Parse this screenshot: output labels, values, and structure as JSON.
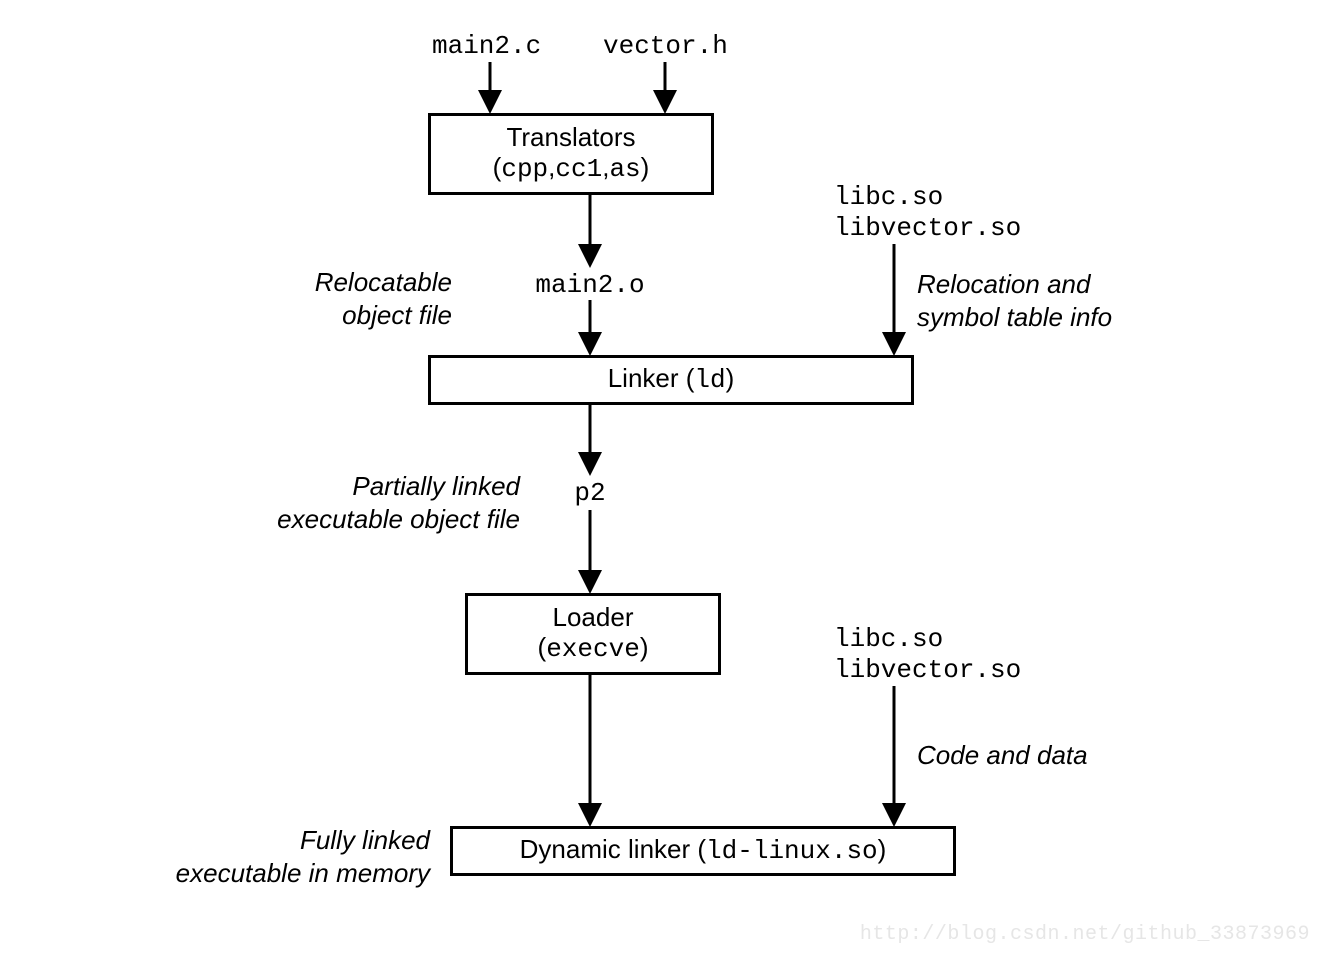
{
  "inputs": {
    "file1": "main2.c",
    "file2": "vector.h"
  },
  "translators": {
    "title": "Translators",
    "subtitle": "(cpp,cc1,as)"
  },
  "relocatable": {
    "line1": "Relocatable",
    "line2": "object file"
  },
  "obj_output": "main2.o",
  "libs1": {
    "line1": "libc.so",
    "line2": "libvector.so"
  },
  "reloc_info": {
    "line1": "Relocation and",
    "line2": "symbol table info"
  },
  "linker": {
    "prefix": "Linker (",
    "mono": "ld",
    "suffix": ")"
  },
  "partially": {
    "line1": "Partially linked",
    "line2": "executable object file"
  },
  "p2": "p2",
  "loader": {
    "title": "Loader",
    "subtitle": "(execve)"
  },
  "libs2": {
    "line1": "libc.so",
    "line2": "libvector.so"
  },
  "code_data": "Code and data",
  "fully": {
    "line1": "Fully linked",
    "line2": "executable in memory"
  },
  "dynlinker": {
    "prefix": "Dynamic linker (",
    "mono": "ld-linux.so",
    "suffix": ")"
  },
  "watermark": "http://blog.csdn.net/github_33873969"
}
